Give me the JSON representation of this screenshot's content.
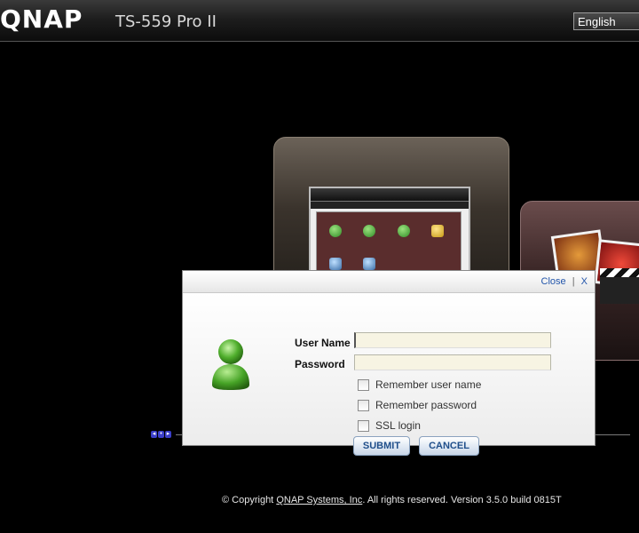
{
  "header": {
    "logo": "QNAP",
    "model": "TS-559 Pro II",
    "language": "English"
  },
  "login": {
    "close_label": "Close",
    "separator": "|",
    "close_x": "X",
    "username_label": "User Name",
    "username_value": "",
    "password_label": "Password",
    "password_value": "",
    "remember_user_label": "Remember user name",
    "remember_password_label": "Remember password",
    "ssl_label": "SSL login",
    "remember_user_checked": false,
    "remember_password_checked": false,
    "ssl_checked": false,
    "submit_label": "SUBMIT",
    "cancel_label": "CANCEL"
  },
  "footer": {
    "copyright_prefix": "© Copyright",
    "company_link": "QNAP Systems, Inc",
    "copyright_suffix": ". All rights reserved. Version 3.5.0 build 0815T"
  },
  "icons": {
    "user": "user-avatar-icon",
    "nav": "carousel-nav-icon"
  },
  "colors": {
    "background": "#000000",
    "button_text": "#1f4e8a",
    "input_background": "#f7f4e3",
    "link": "#2255aa"
  }
}
